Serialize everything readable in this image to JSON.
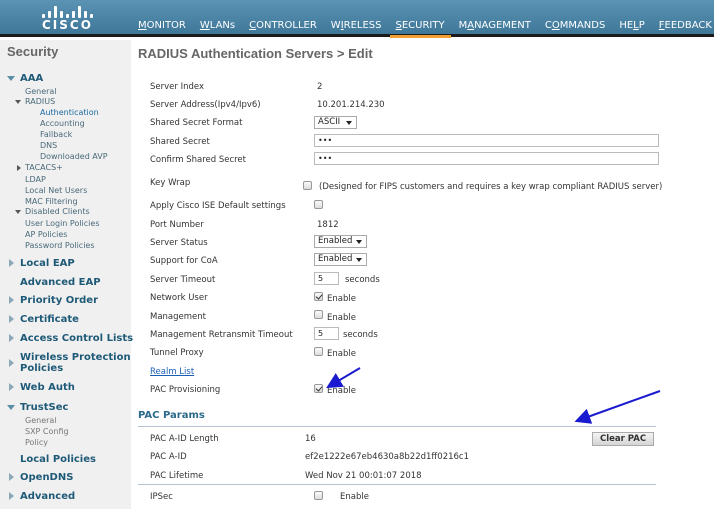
{
  "header": {
    "brand": "CISCO",
    "nav": [
      {
        "label": "MONITOR",
        "key": "M",
        "rest": "ONITOR",
        "active": false
      },
      {
        "label": "WLANs",
        "key": "W",
        "rest": "LANs",
        "active": false
      },
      {
        "label": "CONTROLLER",
        "key": "C",
        "rest": "ONTROLLER",
        "active": false
      },
      {
        "label": "WIRELESS",
        "pre": "W",
        "key": "I",
        "rest": "RELESS",
        "active": false
      },
      {
        "label": "SECURITY",
        "key": "S",
        "rest": "ECURITY",
        "active": true
      },
      {
        "label": "MANAGEMENT",
        "pre": "M",
        "key": "A",
        "rest": "NAGEMENT",
        "active": false
      },
      {
        "label": "COMMANDS",
        "pre": "C",
        "key": "O",
        "rest": "MMANDS",
        "active": false
      },
      {
        "label": "HELP",
        "pre": "HE",
        "key": "L",
        "rest": "P",
        "active": false
      },
      {
        "label": "FEEDBACK",
        "key": "F",
        "rest": "EEDBACK",
        "active": false
      }
    ],
    "accent_color": "#f0a030"
  },
  "sidebar": {
    "title": "Security",
    "aaa": {
      "label": "AAA",
      "general": "General",
      "radius": "RADIUS",
      "radius_items": [
        "Authentication",
        "Accounting",
        "Fallback",
        "DNS",
        "Downloaded AVP"
      ],
      "tacacs": "TACACS+",
      "ldap": "LDAP",
      "local_net_users": "Local Net Users",
      "mac_filtering": "MAC Filtering",
      "disabled_clients": "Disabled Clients",
      "user_login_policies": "User Login Policies",
      "ap_policies": "AP Policies",
      "password_policies": "Password Policies"
    },
    "sections": {
      "local_eap": "Local EAP",
      "advanced_eap": "Advanced EAP",
      "priority_order": "Priority Order",
      "certificate": "Certificate",
      "acl": "Access Control Lists",
      "wpp_line1": "Wireless Protection",
      "wpp_line2": "Policies",
      "web_auth": "Web Auth",
      "trustsec": "TrustSec",
      "trustsec_items": [
        "General",
        "SXP Config",
        "Policy"
      ],
      "local_policies": "Local Policies",
      "opendns": "OpenDNS",
      "advanced": "Advanced"
    }
  },
  "main": {
    "title": "RADIUS Authentication Servers > Edit",
    "fields": {
      "server_index": {
        "label": "Server Index",
        "value": "2"
      },
      "server_address": {
        "label": "Server Address(Ipv4/Ipv6)",
        "value": "10.201.214.230"
      },
      "secret_format": {
        "label": "Shared Secret Format",
        "value": "ASCII"
      },
      "shared_secret": {
        "label": "Shared Secret",
        "value": "•••"
      },
      "confirm_secret": {
        "label": "Confirm Shared Secret",
        "value": "•••"
      },
      "key_wrap": {
        "label": "Key Wrap",
        "checked": false,
        "note": "(Designed for FIPS customers and requires a key wrap compliant RADIUS server)"
      },
      "ise_defaults": {
        "label": "Apply Cisco ISE Default settings",
        "checked": false
      },
      "port": {
        "label": "Port Number",
        "value": "1812"
      },
      "server_status": {
        "label": "Server Status",
        "value": "Enabled"
      },
      "coa": {
        "label": "Support for CoA",
        "value": "Enabled"
      },
      "server_timeout": {
        "label": "Server Timeout",
        "value": "5",
        "unit": "seconds"
      },
      "network_user": {
        "label": "Network User",
        "checked": true,
        "text": "Enable"
      },
      "management": {
        "label": "Management",
        "checked": false,
        "text": "Enable"
      },
      "mgmt_retransmit": {
        "label": "Management Retransmit Timeout",
        "value": "5",
        "unit": "seconds"
      },
      "tunnel_proxy": {
        "label": "Tunnel Proxy",
        "checked": false,
        "text": "Enable"
      },
      "realm_list": "Realm List",
      "pac_provisioning": {
        "label": "PAC Provisioning",
        "checked": true,
        "text": "Enable"
      }
    },
    "pac": {
      "title": "PAC Params",
      "aid_length": {
        "label": "PAC A-ID Length",
        "value": "16"
      },
      "aid": {
        "label": "PAC A-ID",
        "value": "ef2e1222e67eb4630a8b22d1ff0216c1"
      },
      "lifetime": {
        "label": "PAC Lifetime",
        "value": "Wed Nov 21 00:01:07 2018"
      },
      "clear_button": "Clear PAC"
    },
    "ipsec": {
      "label": "IPSec",
      "checked": false,
      "text": "Enable"
    }
  }
}
